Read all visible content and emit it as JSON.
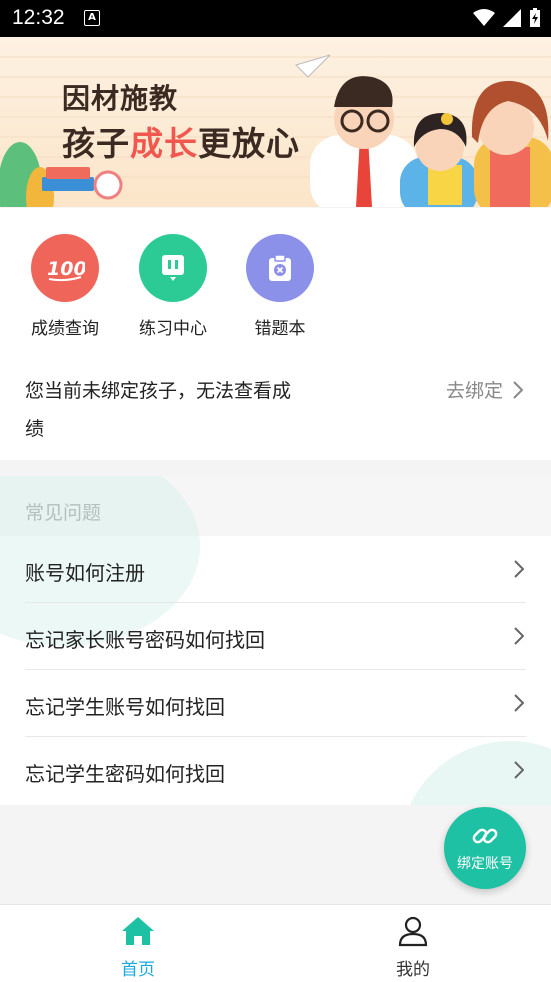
{
  "status_bar": {
    "time": "12:32"
  },
  "banner": {
    "line1": "因材施教",
    "line2_prefix": "孩子",
    "line2_highlight": "成长",
    "line2_suffix": "更放心"
  },
  "quick_menu": [
    {
      "label": "成绩查询",
      "icon": "score-100-icon",
      "color": "#f0655a"
    },
    {
      "label": "练习中心",
      "icon": "practice-icon",
      "color": "#2ccb95"
    },
    {
      "label": "错题本",
      "icon": "wrong-book-icon",
      "color": "#8b90e8"
    }
  ],
  "bind_notice": {
    "text": "您当前未绑定孩子，无法查看成绩",
    "link_label": "去绑定"
  },
  "faq": {
    "title": "常见问题",
    "items": [
      "账号如何注册",
      "忘记家长账号密码如何找回",
      "忘记学生账号如何找回",
      "忘记学生密码如何找回"
    ]
  },
  "fab": {
    "label": "绑定账号",
    "icon": "link-icon",
    "color": "#1fc1a4"
  },
  "tabbar": {
    "tabs": [
      {
        "label": "首页",
        "icon": "home-icon",
        "active": true,
        "color": "#1aa8e0"
      },
      {
        "label": "我的",
        "icon": "user-icon",
        "active": false,
        "color": "#333333"
      }
    ]
  }
}
